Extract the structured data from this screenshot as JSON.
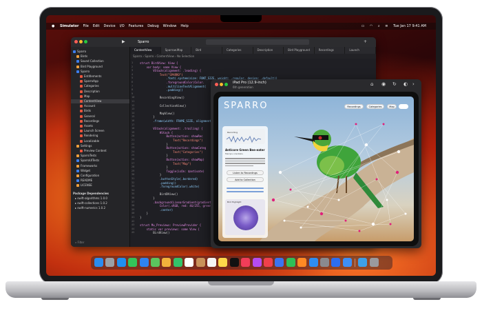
{
  "menubar": {
    "apple": "",
    "items": [
      "Simulator",
      "File",
      "Edit",
      "Device",
      "I/O",
      "Features",
      "Debug",
      "Window",
      "Help"
    ],
    "clock": "Tue Jan 17  9:41 AM"
  },
  "xcode": {
    "scheme": "Sparro",
    "tabs": [
      "ContentView",
      "Sparrow.Map",
      "Bird",
      "Categories",
      "Description",
      "Bird Playground",
      "Recordings",
      "Launch"
    ],
    "sidebar": {
      "items": [
        {
          "label": "Sparro",
          "level": 0
        },
        {
          "label": "Birds",
          "level": 1
        },
        {
          "label": "Sound Collection",
          "level": 1
        },
        {
          "label": "Bird Playground",
          "level": 1
        },
        {
          "label": "Sparro",
          "level": 1
        },
        {
          "label": "Entitlements",
          "level": 2
        },
        {
          "label": "SparroApp",
          "level": 2
        },
        {
          "label": "Categories",
          "level": 2
        },
        {
          "label": "Description",
          "level": 2
        },
        {
          "label": "Map",
          "level": 2
        },
        {
          "label": "ContentView",
          "level": 2,
          "selected": true
        },
        {
          "label": "Account",
          "level": 2
        },
        {
          "label": "Birds",
          "level": 2
        },
        {
          "label": "General",
          "level": 2
        },
        {
          "label": "Recordings",
          "level": 2
        },
        {
          "label": "Assets",
          "level": 2
        },
        {
          "label": "Launch Screen",
          "level": 2
        },
        {
          "label": "Rendering",
          "level": 2
        },
        {
          "label": "Localizable",
          "level": 2
        },
        {
          "label": "Settings",
          "level": 1
        },
        {
          "label": "Preview Content",
          "level": 2
        },
        {
          "label": "SparroTests",
          "level": 1
        },
        {
          "label": "SparroUITests",
          "level": 1
        },
        {
          "label": "Frameworks",
          "level": 1
        },
        {
          "label": "Widget",
          "level": 1
        },
        {
          "label": "Configuration",
          "level": 1
        },
        {
          "label": "README",
          "level": 1
        },
        {
          "label": "LICENSE",
          "level": 1
        }
      ],
      "packages_heading": "Package Dependencies",
      "packages": [
        "swift-algorithms 1.0.0",
        "swift-collections 1.0.2",
        "swift-numerics 1.0.2"
      ],
      "filter_placeholder": "Filter"
    },
    "path": "Sparro  ›  Sparro  ›  ContentView  ›  No Selection",
    "code_lines": [
      "struct BirdView: View {",
      "    var body: some View {",
      "        VStack(alignment: .leading) {",
      "            Text(\"SPARRO\")",
      "                .font(.system(size: FONT_SIZE, weight: .regular, design: .default))",
      "                .foregroundColor(Color.",
      "                .multilineTextAlignment(",
      "                .padding()",
      "",
      "            RecordingView()",
      "",
      "            CollectionView()",
      "",
      "            MapView()",
      "        }",
      "        .frame(width: FRAME_SIZE, alignment",
      "",
      "        VStack(alignment: .trailing) {",
      "            HStack {",
      "                Button(action: showRec",
      "                    Text(\"Recordings\")",
      "                }",
      "                Button(action: showCateg",
      "                    Text(\"Categories\")",
      "                }",
      "                Button(action: showMap)",
      "                    Text(\"Map\")",
      "                }",
      "                Toggle(isOn: $antivate)",
      "            }",
      "            .buttonStyle(.bordered)",
      "            .padding()",
      "            .foregroundColor(.white)",
      "",
      "            BirdDView()",
      "        }",
      "        .background(LinearGradient(gradient:",
      "            Color(.sRGB, red: 46/255, green:",
      "            .center)",
      "    }",
      "}",
      "",
      "struct Mu_Previews: PreviewProvider {",
      "    static var previews: some View {",
      "        BirdView()"
    ]
  },
  "simulator": {
    "device": "iPad Pro (12.9-inch)",
    "generation": "6th generation"
  },
  "app": {
    "title": "SPARRO",
    "nav_buttons": [
      "Recordings",
      "Categories",
      "Map"
    ],
    "card_title": "Anticore Green Bee-eater",
    "card_subtitle": "Merops orientalis",
    "card_button_1": "Listen to Recordings",
    "card_button_2": "Add to Collection",
    "bird_highlight_label": "Bird Highlight",
    "recording_label": "Recording"
  },
  "dock": {
    "icons": [
      "finder-icon",
      "launchpad-icon",
      "safari-icon",
      "messages-icon",
      "mail-icon",
      "maps-icon",
      "photos-icon",
      "facetime-icon",
      "calendar-icon",
      "contacts-icon",
      "reminders-icon",
      "notes-icon",
      "tv-icon",
      "music-icon",
      "podcasts-icon",
      "news-icon",
      "keynote-icon",
      "numbers-icon",
      "pages-icon",
      "app-store-icon",
      "settings-icon",
      "xcode-icon",
      "simulator-icon",
      "folder-icon",
      "trash-icon"
    ],
    "colors": [
      "#2a8cf0",
      "#9aa0a6",
      "#1f8ff0",
      "#33c45a",
      "#2f84ef",
      "#5bc55e",
      "#f2b33b",
      "#32c36a",
      "#ffffff",
      "#c9925a",
      "#f5f5f5",
      "#ffd84a",
      "#111111",
      "#f23d59",
      "#b54cf0",
      "#f0404a",
      "#3b73f0",
      "#2fbf57",
      "#ff8a24",
      "#2f8ef3",
      "#8a8a8e",
      "#2d6ef0",
      "#3e8ff5",
      "#3ea0e8",
      "#9a9a9e"
    ]
  }
}
